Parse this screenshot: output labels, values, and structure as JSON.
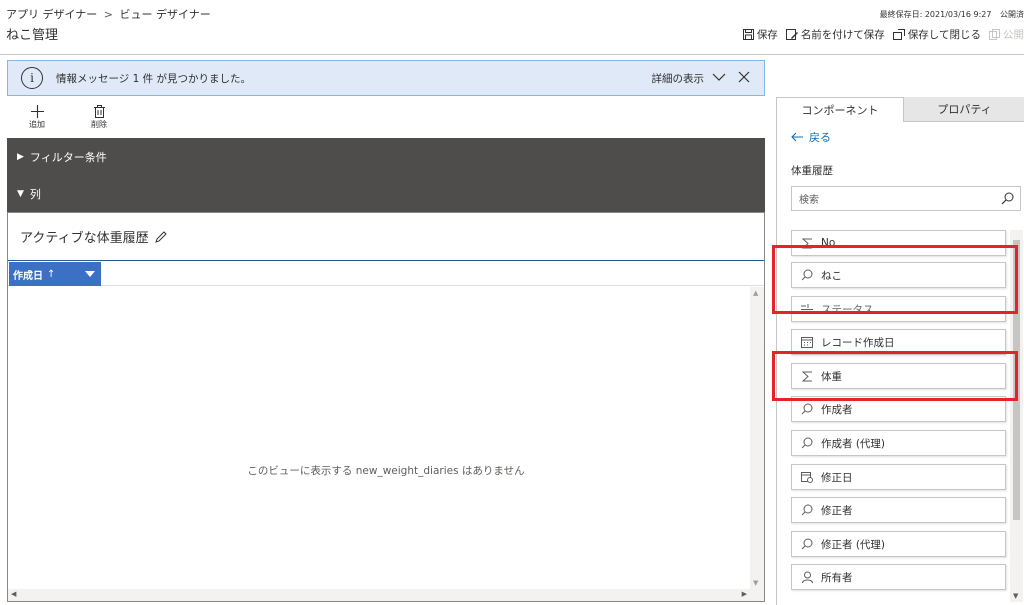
{
  "header": {
    "breadcrumb_app": "アプリ デザイナー",
    "breadcrumb_view": "ビュー デザイナー",
    "title": "ねこ管理",
    "last_saved": "最終保存日: 2021/03/16 9:27",
    "status": "公開済",
    "commands": {
      "save": "保存",
      "save_as": "名前を付けて保存",
      "save_close": "保存して閉じる",
      "publish": "公開"
    }
  },
  "message": {
    "text": "情報メッセージ 1 件 が見つかりました。",
    "detail": "詳細の表示"
  },
  "toolbar": {
    "add": "追加",
    "delete": "削除"
  },
  "left": {
    "filter_label": "フィルター条件",
    "columns_label": "列",
    "view_name": "アクティブな体重履歴",
    "column_header": "作成日",
    "sort_arrow": "↑",
    "empty_message": "このビューに表示する new_weight_diaries はありません"
  },
  "right": {
    "tabs": [
      "コンポーネント",
      "プロパティ"
    ],
    "back": "戻る",
    "entity": "体重履歴",
    "search_placeholder": "検索",
    "fields": [
      {
        "label": "No",
        "icon": "sum-icon"
      },
      {
        "label": "ねこ",
        "icon": "lookup-icon"
      },
      {
        "label": "ステータス",
        "icon": "option-icon"
      },
      {
        "label": "レコード作成日",
        "icon": "calendar-icon"
      },
      {
        "label": "体重",
        "icon": "sum-icon"
      },
      {
        "label": "作成者",
        "icon": "lookup-icon"
      },
      {
        "label": "作成者 (代理)",
        "icon": "lookup-icon"
      },
      {
        "label": "修正日",
        "icon": "date-edit-icon"
      },
      {
        "label": "修正者",
        "icon": "lookup-icon"
      },
      {
        "label": "修正者 (代理)",
        "icon": "lookup-icon"
      },
      {
        "label": "所有者",
        "icon": "person-icon"
      }
    ]
  },
  "colors": {
    "highlight": "#e3242b",
    "accent": "#3b70c4",
    "dark_bar": "#4e4d4b",
    "message_bg": "#dfe9f7"
  }
}
